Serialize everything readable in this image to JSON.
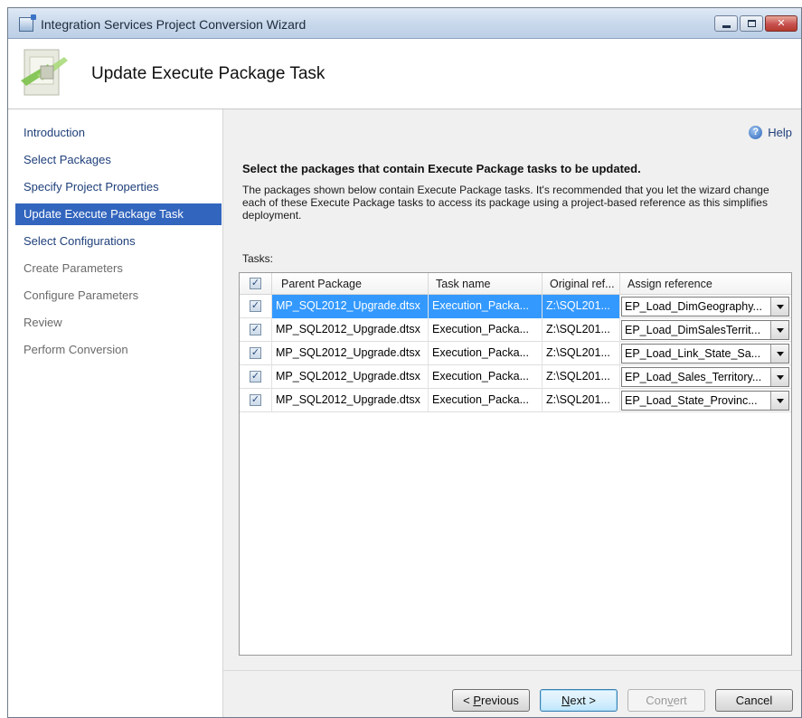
{
  "window": {
    "title": "Integration Services Project Conversion Wizard",
    "controls": [
      "minimize",
      "maximize",
      "close"
    ]
  },
  "header": {
    "title": "Update Execute Package Task",
    "icon": "wizard-package-icon"
  },
  "sidebar": {
    "items": [
      {
        "label": "Introduction",
        "state": "link"
      },
      {
        "label": "Select Packages",
        "state": "link"
      },
      {
        "label": "Specify Project Properties",
        "state": "link"
      },
      {
        "label": "Update Execute Package Task",
        "state": "selected"
      },
      {
        "label": "Select Configurations",
        "state": "link"
      },
      {
        "label": "Create Parameters",
        "state": "disabled"
      },
      {
        "label": "Configure Parameters",
        "state": "disabled"
      },
      {
        "label": "Review",
        "state": "disabled"
      },
      {
        "label": "Perform Conversion",
        "state": "disabled"
      }
    ]
  },
  "main": {
    "help_label": "Help",
    "heading": "Select the packages that contain Execute Package tasks to be updated.",
    "description": "The packages shown below contain Execute Package tasks. It's recommended that you let the wizard change each of these Execute Package tasks to access its package using a project-based reference as this simplifies deployment.",
    "tasks_label": "Tasks:",
    "columns": [
      "Parent Package",
      "Task name",
      "Original ref...",
      "Assign reference"
    ],
    "rows": [
      {
        "checked": true,
        "parent_package": "MP_SQL2012_Upgrade.dtsx",
        "task_name": "Execution_Packa...",
        "original_ref": "Z:\\SQL201...",
        "assign_reference": "EP_Load_DimGeography..."
      },
      {
        "checked": true,
        "parent_package": "MP_SQL2012_Upgrade.dtsx",
        "task_name": "Execution_Packa...",
        "original_ref": "Z:\\SQL201...",
        "assign_reference": "EP_Load_DimSalesTerrit..."
      },
      {
        "checked": true,
        "parent_package": "MP_SQL2012_Upgrade.dtsx",
        "task_name": "Execution_Packa...",
        "original_ref": "Z:\\SQL201...",
        "assign_reference": "EP_Load_Link_State_Sa..."
      },
      {
        "checked": true,
        "parent_package": "MP_SQL2012_Upgrade.dtsx",
        "task_name": "Execution_Packa...",
        "original_ref": "Z:\\SQL201...",
        "assign_reference": "EP_Load_Sales_Territory..."
      },
      {
        "checked": true,
        "parent_package": "MP_SQL2012_Upgrade.dtsx",
        "task_name": "Execution_Packa...",
        "original_ref": "Z:\\SQL201...",
        "assign_reference": "EP_Load_State_Provinc..."
      }
    ],
    "selected_row": 0
  },
  "footer": {
    "previous": {
      "mnemonic_pre": "< ",
      "mnemonic": "P",
      "rest": "revious"
    },
    "next": {
      "mnemonic": "N",
      "rest": "ext >"
    },
    "convert": {
      "pre": "Con",
      "mnemonic": "v",
      "rest": "ert"
    },
    "cancel": "Cancel"
  },
  "colors": {
    "nav_selected_bg": "#3265be",
    "row_selected_bg": "#3399ff",
    "link_text": "#1f3f7a"
  }
}
